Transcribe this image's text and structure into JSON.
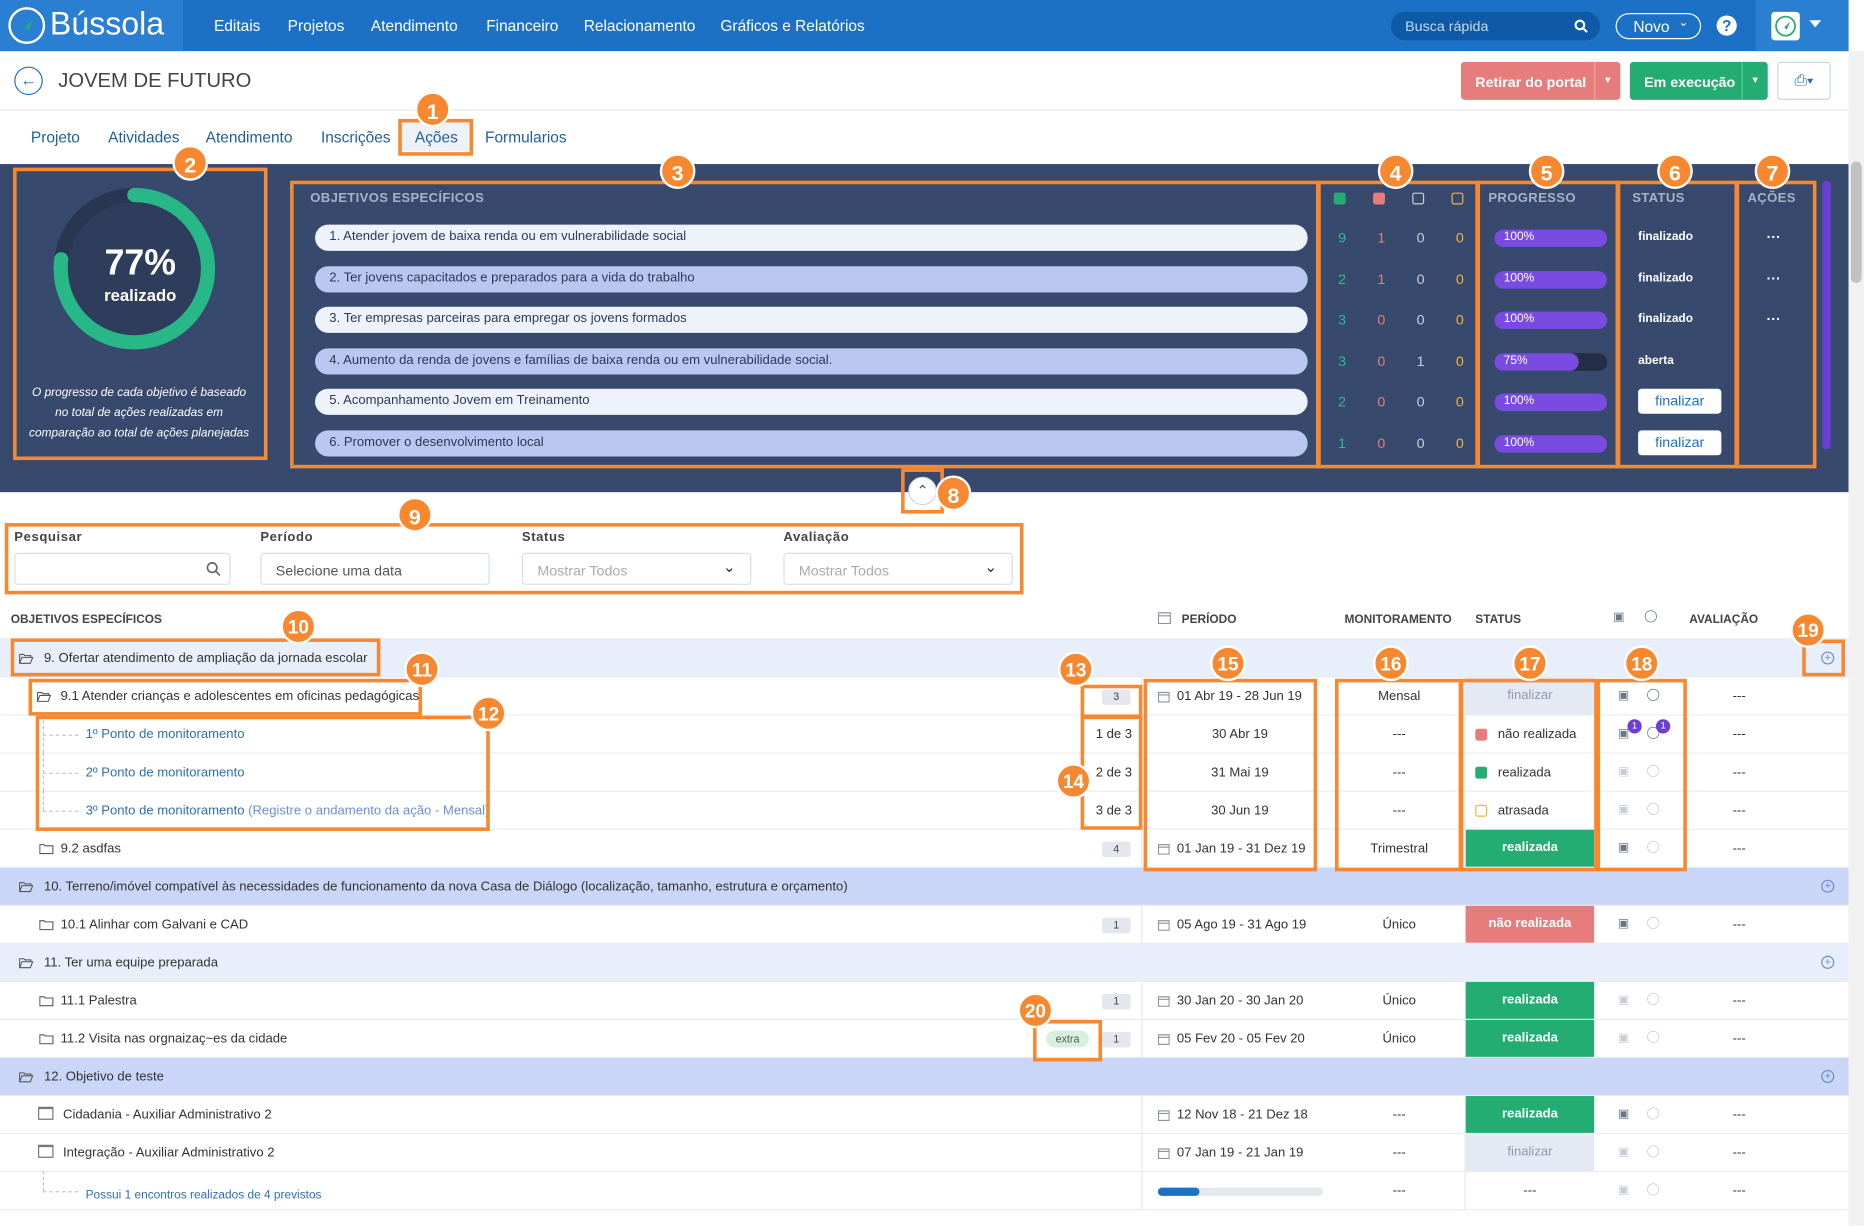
{
  "topbar": {
    "logo": "Bússola",
    "nav": [
      "Editais",
      "Projetos",
      "Atendimento",
      "Financeiro",
      "Relacionamento",
      "Gráficos e Relatórios"
    ],
    "search_placeholder": "Busca rápida",
    "novo": "Novo",
    "help": "?"
  },
  "header": {
    "title": "JOVEM DE FUTURO",
    "btn_retirar": "Retirar do portal",
    "btn_execucao": "Em execução"
  },
  "tabs": [
    "Projeto",
    "Atividades",
    "Atendimento",
    "Inscrições",
    "Ações",
    "Formularios"
  ],
  "summary": {
    "percent": "77%",
    "percent_value": 77,
    "label": "realizado",
    "note": "O progresso de cada objetivo é baseado no total de ações realizadas em comparação ao total de ações planejadas",
    "head_objetivos": "OBJETIVOS ESPECÍFICOS",
    "head_progresso": "PROGRESSO",
    "head_status": "STATUS",
    "head_acoes": "AÇÕES",
    "dots": "···",
    "objectives": [
      {
        "text": "1. Atender jovem de baixa renda ou em vulnerabilidade social",
        "c": [
          "9",
          "1",
          "0",
          "0"
        ],
        "progress": "100%",
        "pv": 100,
        "status": "finalizado",
        "action": "···"
      },
      {
        "text": "2. Ter jovens capacitados e preparados para a vida do trabalho",
        "c": [
          "2",
          "1",
          "0",
          "0"
        ],
        "progress": "100%",
        "pv": 100,
        "status": "finalizado",
        "action": "···"
      },
      {
        "text": "3. Ter empresas parceiras para empregar os jovens formados",
        "c": [
          "3",
          "0",
          "0",
          "0"
        ],
        "progress": "100%",
        "pv": 100,
        "status": "finalizado",
        "action": "···"
      },
      {
        "text": "4. Aumento da renda de jovens e famílias de baixa renda ou em vulnerabilidade social.",
        "c": [
          "3",
          "0",
          "1",
          "0"
        ],
        "progress": "75%",
        "pv": 75,
        "status": "aberta",
        "action": ""
      },
      {
        "text": "5. Acompanhamento Jovem em Treinamento",
        "c": [
          "2",
          "0",
          "0",
          "0"
        ],
        "progress": "100%",
        "pv": 100,
        "status": "finalizar",
        "action": ""
      },
      {
        "text": "6. Promover o desenvolvimento local",
        "c": [
          "1",
          "0",
          "0",
          "0"
        ],
        "progress": "100%",
        "pv": 100,
        "status": "finalizar",
        "action": ""
      }
    ]
  },
  "filters": {
    "pesquisar": "Pesquisar",
    "periodo": "Período",
    "periodo_value": "Selecione uma data",
    "status": "Status",
    "status_value": "Mostrar Todos",
    "avaliacao": "Avaliação",
    "avaliacao_value": "Mostrar Todos"
  },
  "table": {
    "headers": {
      "obj": "OBJETIVOS ESPECÍFICOS",
      "periodo": "PERÍODO",
      "monit": "MONITORAMENTO",
      "status": "STATUS",
      "aval": "AVALIAÇÃO"
    },
    "rows": [
      {
        "type": "group",
        "text": "9. Ofertar atendimento de ampliação da jornada escolar"
      },
      {
        "type": "action",
        "text": "9.1 Atender crianças e adolescentes em oficinas pedagógicas",
        "count": "3",
        "period": "01 Abr 19 - 28 Jun 19",
        "monit": "Mensal",
        "status": "finalizar",
        "stype": "pending",
        "aval": "---",
        "icons": "normal"
      },
      {
        "type": "point",
        "text": "1º Ponto de monitoramento",
        "frac": "1 de 3",
        "period": "30 Abr 19",
        "monit": "---",
        "status": "não realizada",
        "stype": "sq-red",
        "aval": "---",
        "icons": "badged",
        "b1": "1",
        "b2": "1"
      },
      {
        "type": "point",
        "text": "2º Ponto de monitoramento",
        "frac": "2 de 3",
        "period": "31 Mai 19",
        "monit": "---",
        "status": "realizada",
        "stype": "sq-green",
        "aval": "---",
        "icons": "dim"
      },
      {
        "type": "point",
        "text": "3º Ponto de monitoramento",
        "extra": "(Registre o andamento da ação - Mensal)",
        "frac": "3 de 3",
        "period": "30 Jun 19",
        "monit": "---",
        "status": "atrasada",
        "stype": "sq-orange",
        "aval": "---",
        "icons": "dim"
      },
      {
        "type": "action",
        "text": "9.2 asdfas",
        "count": "4",
        "period": "01 Jan 19 - 31 Dez 19",
        "monit": "Trimestral",
        "status": "realizada",
        "stype": "green",
        "aval": "---",
        "icons": "half"
      },
      {
        "type": "group2",
        "text": "10. Terreno/imóvel compatível às necessidades de funcionamento da nova Casa de Diálogo (localização, tamanho, estrutura e orçamento)"
      },
      {
        "type": "action",
        "text": "10.1 Alinhar com Galvani e CAD",
        "count": "1",
        "period": "05 Ago 19 - 31 Ago 19",
        "monit": "Único",
        "status": "não realizada",
        "stype": "red",
        "aval": "---",
        "icons": "half"
      },
      {
        "type": "group",
        "text": "11. Ter uma equipe preparada"
      },
      {
        "type": "action",
        "text": "11.1 Palestra",
        "count": "1",
        "period": "30 Jan 20 - 30 Jan 20",
        "monit": "Único",
        "status": "realizada",
        "stype": "green",
        "aval": "---",
        "icons": "dim"
      },
      {
        "type": "action",
        "text": "11.2 Visita nas orgnaizaç~es da cidade",
        "count": "1",
        "tag": "extra",
        "period": "05 Fev 20 - 05 Fev 20",
        "monit": "Único",
        "status": "realizada",
        "stype": "green",
        "aval": "---",
        "icons": "dim"
      },
      {
        "type": "group2",
        "text": "12. Objetivo de teste"
      },
      {
        "type": "event",
        "text": "Cidadania - Auxiliar Administrativo 2",
        "period": "12 Nov 18 - 21 Dez 18",
        "monit": "---",
        "status": "realizada",
        "stype": "green",
        "aval": "---",
        "icons": "half"
      },
      {
        "type": "event",
        "text": "Integração - Auxiliar Administrativo 2",
        "period": "07 Jan 19 - 21 Jan 19",
        "monit": "---",
        "status": "finalizar",
        "stype": "pending",
        "aval": "---",
        "icons": "dim"
      },
      {
        "type": "sub",
        "text": "Possui 1 encontros realizados de 4 previstos",
        "progress_value": 0.25,
        "monit": "---",
        "status": "---",
        "aval": "---",
        "icons": "dim"
      }
    ]
  },
  "annotations": [
    "1",
    "2",
    "3",
    "4",
    "5",
    "6",
    "7",
    "8",
    "9",
    "10",
    "11",
    "12",
    "13",
    "14",
    "15",
    "16",
    "17",
    "18",
    "19",
    "20"
  ],
  "colors": {
    "brand": "#1c71c6",
    "panel": "#374a6e",
    "green": "#24ad73",
    "red": "#e67c7c",
    "annotation": "#f7882f",
    "purple": "#7a4be0"
  }
}
